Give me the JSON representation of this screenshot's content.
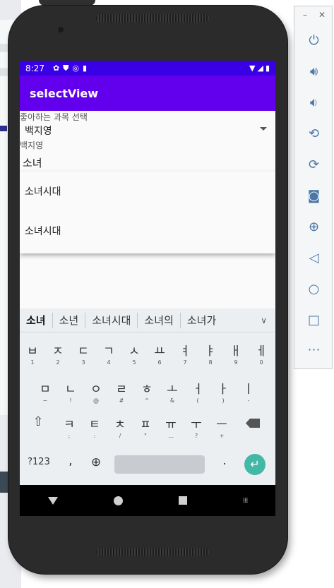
{
  "status_bar": {
    "time": "8:27"
  },
  "app_bar": {
    "title": "selectView"
  },
  "form": {
    "prompt": "좋아하는 과목 선택",
    "spinner_value": "백지영",
    "subtext": "백지영",
    "input_value": "소녀"
  },
  "dropdown": {
    "items": [
      "소녀시대",
      "소녀시대"
    ]
  },
  "keyboard": {
    "suggestions": [
      "소녀",
      "소년",
      "소녀시대",
      "소녀의",
      "소녀가"
    ],
    "row1": [
      {
        "main": "ㅂ",
        "hint": "1"
      },
      {
        "main": "ㅈ",
        "hint": "2"
      },
      {
        "main": "ㄷ",
        "hint": "3"
      },
      {
        "main": "ㄱ",
        "hint": "4"
      },
      {
        "main": "ㅅ",
        "hint": "5"
      },
      {
        "main": "ㅛ",
        "hint": "6"
      },
      {
        "main": "ㅕ",
        "hint": "7"
      },
      {
        "main": "ㅑ",
        "hint": "8"
      },
      {
        "main": "ㅐ",
        "hint": "9"
      },
      {
        "main": "ㅔ",
        "hint": "0"
      }
    ],
    "row2": [
      {
        "main": "ㅁ",
        "hint": "~"
      },
      {
        "main": "ㄴ",
        "hint": "!"
      },
      {
        "main": "ㅇ",
        "hint": "@"
      },
      {
        "main": "ㄹ",
        "hint": "#"
      },
      {
        "main": "ㅎ",
        "hint": "^"
      },
      {
        "main": "ㅗ",
        "hint": "&"
      },
      {
        "main": "ㅓ",
        "hint": "("
      },
      {
        "main": "ㅏ",
        "hint": ")"
      },
      {
        "main": "ㅣ",
        "hint": "-"
      }
    ],
    "row3": [
      {
        "main": "ㅋ",
        "hint": ";"
      },
      {
        "main": "ㅌ",
        "hint": ":"
      },
      {
        "main": "ㅊ",
        "hint": "/"
      },
      {
        "main": "ㅍ",
        "hint": "\""
      },
      {
        "main": "ㅠ",
        "hint": "…"
      },
      {
        "main": "ㅜ",
        "hint": "?"
      },
      {
        "main": "ㅡ",
        "hint": "+"
      }
    ],
    "symbols_key": "?123",
    "comma_key": ",",
    "period_key": "."
  },
  "colors": {
    "status_bar": "#3a00e5",
    "app_bar": "#6200ee",
    "input_underline": "#1aa8a0",
    "enter_key": "#43b8a7",
    "toolbar_icon": "#4b77a6"
  },
  "icons": {
    "status": [
      "gear-icon",
      "shield-icon",
      "sync-icon",
      "sd-card-icon",
      "wifi-icon",
      "signal-icon",
      "battery-icon"
    ],
    "toolbar": [
      "power-icon",
      "volume-up-icon",
      "volume-down-icon",
      "rotate-left-icon",
      "rotate-right-icon",
      "camera-icon",
      "zoom-icon",
      "back-icon",
      "home-icon",
      "overview-icon",
      "more-icon"
    ]
  }
}
